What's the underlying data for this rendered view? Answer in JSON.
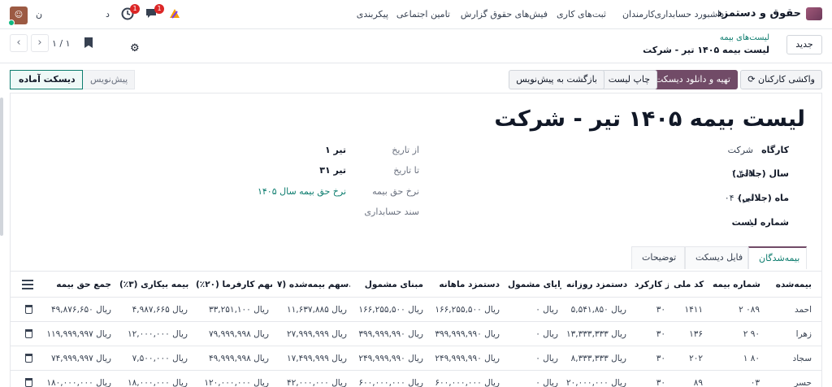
{
  "nav": {
    "app_name": "حقوق و دستمزد",
    "menu": [
      "داشبورد حسابداری",
      "کارمندان",
      "ثبت‌های کاری",
      "فیش‌های حقوق",
      "گزارش",
      "تامین اجتماعی",
      "پیکربندی"
    ],
    "activity_badge": "1",
    "messages_badge": "1",
    "company_letter": "د",
    "user_initial": "ن"
  },
  "control": {
    "new_label": "جدید",
    "breadcrumb_parent": "لیست‌های بیمه",
    "breadcrumb_current": "لیست بیمه ۱۴۰۵ تیر - شرکت",
    "pager": "۱ / ۱"
  },
  "actions": {
    "fetch_employees": "واکشی کارکنان",
    "prepare_download": "تهیه و دانلود دیسکت",
    "print_list": "چاپ لیست",
    "back_to_draft": "بازگشت به پیش‌نویس",
    "status_draft": "پیش‌نویس",
    "status_ready": "دیسکت آماده"
  },
  "form": {
    "title": "لیست بیمه ۱۴۰۵ تیر - شرکت",
    "right_fields": [
      {
        "label": "کارگاه",
        "value": "شرکت"
      },
      {
        "label": "سال (جلالی)",
        "value": "۱,۴۰۵"
      },
      {
        "label": "ماه (جلالی)",
        "value": "۰۴ - تیر"
      },
      {
        "label": "شماره لیست",
        "value": "۰۱"
      }
    ],
    "left_fields": [
      {
        "label": "از تاریخ",
        "value": "۱ تیر"
      },
      {
        "label": "تا تاریخ",
        "value": "۳۱ تیر"
      },
      {
        "label": "نرخ حق بیمه",
        "value": "نرخ حق بیمه سال ۱۴۰۵"
      },
      {
        "label": "سند حسابداری",
        "value": ""
      }
    ]
  },
  "tabs": [
    "بیمه‌شدگان",
    "فایل دیسکت",
    "توضیحات"
  ],
  "table": {
    "columns": [
      "بیمه‌شده",
      "شماره بیمه",
      "کد ملی",
      "روز کارکرد",
      "دستمزد روزانه",
      "مزایای مشمول",
      "دستمزد ماهانه",
      "مبنای مشمول",
      "سهم بیمه‌شده (۷...",
      "سهم کارفرما (۲۰٪)",
      "بیمه بیکاری (۳٪)",
      "جمع حق بیمه"
    ],
    "rows": [
      [
        "احمد",
        "۲ ۰۸۹",
        "۱۴۱۱",
        "۳۰",
        "ریال ۵,۵۴۱,۸۵۰",
        "ریال ۰",
        "ریال ۱۶۶,۲۵۵,۵۰۰",
        "ریال ۱۶۶,۲۵۵,۵۰۰",
        "ریال ۱۱,۶۳۷,۸۸۵",
        "ریال ۳۳,۲۵۱,۱۰۰",
        "ریال ۴,۹۸۷,۶۶۵",
        "ریال ۴۹,۸۷۶,۶۵۰"
      ],
      [
        "زهرا",
        "۲ ۹۰",
        "۱۳۶",
        "۳۰",
        "ریال ۱۳,۳۳۳,۳۳۳",
        "ریال ۰",
        "ریال ۳۹۹,۹۹۹,۹۹۰",
        "ریال ۳۹۹,۹۹۹,۹۹۰",
        "ریال ۲۷,۹۹۹,۹۹۹",
        "ریال ۷۹,۹۹۹,۹۹۸",
        "ریال ۱۲,۰۰۰,۰۰۰",
        "ریال ۱۱۹,۹۹۹,۹۹۷"
      ],
      [
        "سجاد",
        "۱ ۸۰",
        "۲۰۲",
        "۳۰",
        "ریال ۸,۳۳۳,۳۳۳",
        "ریال ۰",
        "ریال ۲۴۹,۹۹۹,۹۹۰",
        "ریال ۲۴۹,۹۹۹,۹۹۰",
        "ریال ۱۷,۴۹۹,۹۹۹",
        "ریال ۴۹,۹۹۹,۹۹۸",
        "ریال ۷,۵۰۰,۰۰۰",
        "ریال ۷۴,۹۹۹,۹۹۷"
      ],
      [
        "حسر",
        "۰۳",
        "۸۹",
        "۳۰",
        "ریال ۲۰,۰۰۰,۰۰۰",
        "ریال ۰",
        "ریال ۶۰۰,۰۰۰,۰۰۰",
        "ریال ۶۰۰,۰۰۰,۰۰۰",
        "ریال ۴۲,۰۰۰,۰۰۰",
        "ریال ۱۲۰,۰۰۰,۰۰۰",
        "ریال ۱۸,۰۰۰,۰۰۰",
        "ریال ۱۸۰,۰۰۰,۰۰۰"
      ]
    ]
  }
}
